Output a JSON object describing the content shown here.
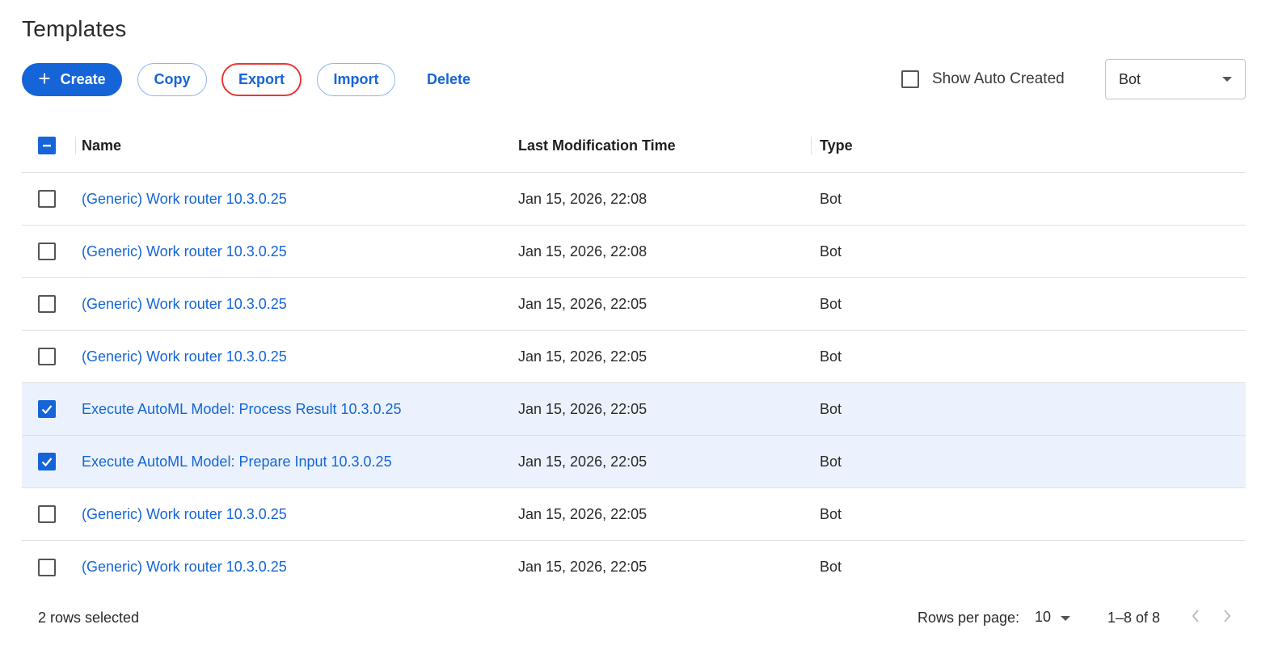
{
  "page_title": "Templates",
  "toolbar": {
    "create_label": "Create",
    "copy_label": "Copy",
    "export_label": "Export",
    "import_label": "Import",
    "delete_label": "Delete",
    "show_auto_created_label": "Show Auto Created",
    "show_auto_created_checked": false,
    "type_filter_value": "Bot"
  },
  "table": {
    "header_checkbox_state": "indeterminate",
    "columns": {
      "name": "Name",
      "time": "Last Modification Time",
      "type": "Type"
    },
    "rows": [
      {
        "name": "(Generic) Work router 10.3.0.25",
        "time": "Jan 15, 2026, 22:08",
        "type": "Bot",
        "selected": false
      },
      {
        "name": "(Generic) Work router 10.3.0.25",
        "time": "Jan 15, 2026, 22:08",
        "type": "Bot",
        "selected": false
      },
      {
        "name": "(Generic) Work router 10.3.0.25",
        "time": "Jan 15, 2026, 22:05",
        "type": "Bot",
        "selected": false
      },
      {
        "name": "(Generic) Work router 10.3.0.25",
        "time": "Jan 15, 2026, 22:05",
        "type": "Bot",
        "selected": false
      },
      {
        "name": "Execute AutoML Model: Process Result 10.3.0.25",
        "time": "Jan 15, 2026, 22:05",
        "type": "Bot",
        "selected": true
      },
      {
        "name": "Execute AutoML Model: Prepare Input 10.3.0.25",
        "time": "Jan 15, 2026, 22:05",
        "type": "Bot",
        "selected": true
      },
      {
        "name": "(Generic) Work router 10.3.0.25",
        "time": "Jan 15, 2026, 22:05",
        "type": "Bot",
        "selected": false
      },
      {
        "name": "(Generic) Work router 10.3.0.25",
        "time": "Jan 15, 2026, 22:05",
        "type": "Bot",
        "selected": false
      }
    ]
  },
  "footer": {
    "selected_text": "2 rows selected",
    "rows_per_page_label": "Rows per page:",
    "rows_per_page_value": "10",
    "range_text": "1–8 of 8"
  },
  "colors": {
    "accent": "#1565d8",
    "export_highlight": "#e53935",
    "selected_row": "#ebf2fd"
  },
  "icons": {
    "create": "plus-icon",
    "select_caret": "caret-down-icon",
    "prev": "chevron-left-icon",
    "next": "chevron-right-icon",
    "check": "check-icon",
    "indeterminate": "minus-icon"
  }
}
